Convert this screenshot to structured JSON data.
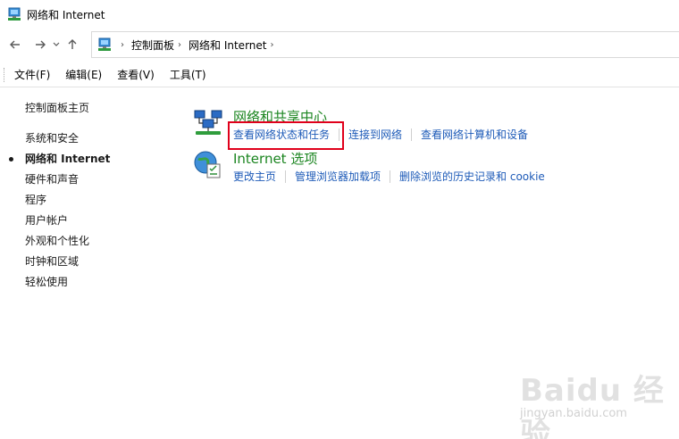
{
  "window": {
    "title": "网络和 Internet"
  },
  "nav": {
    "back_icon": "arrow-left-icon",
    "forward_icon": "arrow-right-icon",
    "recent_icon": "chevron-down-icon",
    "up_icon": "arrow-up-icon"
  },
  "breadcrumb": {
    "items": [
      "控制面板",
      "网络和 Internet"
    ]
  },
  "menu": {
    "items": [
      "文件(F)",
      "编辑(E)",
      "查看(V)",
      "工具(T)"
    ]
  },
  "sidebar": {
    "home": "控制面板主页",
    "items": [
      "系统和安全",
      "网络和 Internet",
      "硬件和声音",
      "程序",
      "用户帐户",
      "外观和个性化",
      "时钟和区域",
      "轻松使用"
    ],
    "active_index": 1
  },
  "categories": [
    {
      "title": "网络和共享中心",
      "icon": "network-sharing-center-icon",
      "links": [
        "查看网络状态和任务",
        "连接到网络",
        "查看网络计算机和设备"
      ]
    },
    {
      "title": "Internet 选项",
      "icon": "internet-options-icon",
      "links": [
        "更改主页",
        "管理浏览器加载项",
        "删除浏览的历史记录和 cookie"
      ]
    }
  ],
  "watermark": {
    "logo": "Baidu 经验",
    "url": "jingyan.baidu.com"
  },
  "colors": {
    "link": "#1e5bb8",
    "category_title": "#1b8520",
    "highlight": "#e0001b"
  }
}
